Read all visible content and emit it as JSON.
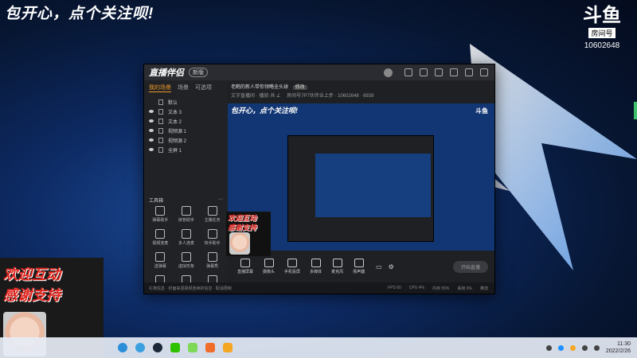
{
  "overlay": {
    "headline": "包开心，点个关注呗!",
    "welcome_line1": "欢迎互动",
    "welcome_line2": "感谢支持"
  },
  "douyu": {
    "mark": "斗鱼",
    "label": "房间号",
    "room_number": "10602648"
  },
  "app": {
    "name": "直播伴侣",
    "version": "新版",
    "tabs": [
      "我的场景",
      "场景",
      "可选项"
    ],
    "sources": [
      "默认",
      "文本 3",
      "文本 2",
      "视频源 1",
      "视频源 2",
      "全屏 1"
    ],
    "toolbox_title": "工具箱",
    "tools": [
      "弹幕助手",
      "房管助手",
      "主播任务",
      "视频连麦",
      "多人连麦",
      "快手助手",
      "送弹幕",
      "虚拟形象",
      "弹幕秀",
      "",
      "",
      ""
    ],
    "room_title": "老鹤的新人带你领略全头球",
    "room_tag": "修改",
    "room_meta": "文字直播间 · 播放·共 ∠",
    "room_meta2": "房间号7P7伙伴业上步 · 10602648 · 6939",
    "preview_headline": "包开心，点个关注呗!",
    "controls": [
      "直播屏幕",
      "摄像头",
      "手机投屏",
      "多媒体",
      "麦克风",
      "扬声器"
    ],
    "start_button": "开始直播",
    "status_left": "礼物信息 · 封面来源视频连续的信息 · 取消限制",
    "status_stats": [
      "FPS 60",
      "CPU 4%",
      "内存 55%",
      "丢帧 0%",
      "推流"
    ]
  },
  "taskbar": {
    "time": "11:30",
    "date": "2022/2/26"
  }
}
